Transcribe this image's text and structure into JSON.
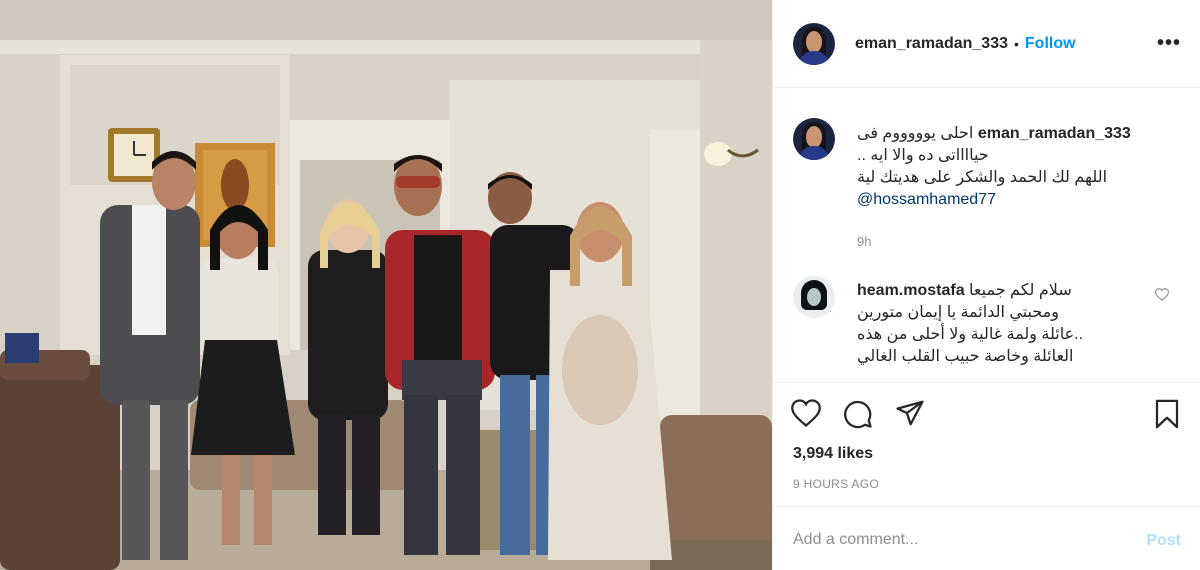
{
  "post": {
    "author": "eman_ramadan_333",
    "follow_label": "Follow",
    "separator": "•",
    "more_label": "•••"
  },
  "caption": {
    "username": "eman_ramadan_333",
    "line1": "احلى يوووووم فى",
    "line2": "حيااااتى ده والا ايه ..",
    "line3": "اللهم لك الحمد والشكر على هديتك لية",
    "mention": "@hossamhamed77",
    "time": "9h"
  },
  "comment": {
    "username": "heam.mostafa",
    "line1": "سلام لكم جميعا",
    "line2": "ومحبتي الدائمة يا إيمان متورين",
    "line3": "..عائلة ولمة غالية ولا أحلى من هذه",
    "line4": "العائلة وخاصة حبيب القلب الغالي"
  },
  "actions": {
    "like_icon": "heart-icon",
    "comment_icon": "comment-icon",
    "share_icon": "paper-plane-icon",
    "save_icon": "bookmark-icon"
  },
  "likes": "3,994 likes",
  "posted_ago": "9 HOURS AGO",
  "add_comment": {
    "placeholder": "Add a comment...",
    "post_label": "Post"
  },
  "colors": {
    "accent": "#0095f6",
    "post_disabled": "#b2dffc",
    "muted": "#8e8e8e",
    "text": "#262626",
    "border": "#efefef"
  }
}
